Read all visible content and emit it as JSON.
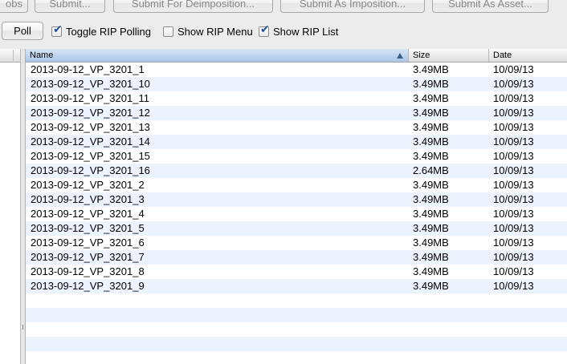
{
  "toolbar_top": {
    "jobs_partial": "obs",
    "submit": "Submit...",
    "submit_deimposition": "Submit For Deimposition...",
    "submit_imposition": "Submit As Imposition...",
    "submit_asset": "Submit As Asset..."
  },
  "toolbar_second": {
    "poll": "Poll",
    "toggle_rip_polling": {
      "label": "Toggle RIP Polling",
      "checked": true
    },
    "show_rip_menu": {
      "label": "Show RIP Menu",
      "checked": false
    },
    "show_rip_list": {
      "label": "Show RIP List",
      "checked": true
    }
  },
  "table": {
    "columns": {
      "name": "Name",
      "size": "Size",
      "date": "Date"
    },
    "sort": {
      "column": "name",
      "direction": "ascending"
    },
    "rows": [
      {
        "name": "2013-09-12_VP_3201_1",
        "size": "3.49MB",
        "date": "10/09/13"
      },
      {
        "name": "2013-09-12_VP_3201_10",
        "size": "3.49MB",
        "date": "10/09/13"
      },
      {
        "name": "2013-09-12_VP_3201_11",
        "size": "3.49MB",
        "date": "10/09/13"
      },
      {
        "name": "2013-09-12_VP_3201_12",
        "size": "3.49MB",
        "date": "10/09/13"
      },
      {
        "name": "2013-09-12_VP_3201_13",
        "size": "3.49MB",
        "date": "10/09/13"
      },
      {
        "name": "2013-09-12_VP_3201_14",
        "size": "3.49MB",
        "date": "10/09/13"
      },
      {
        "name": "2013-09-12_VP_3201_15",
        "size": "3.49MB",
        "date": "10/09/13"
      },
      {
        "name": "2013-09-12_VP_3201_16",
        "size": "2.64MB",
        "date": "10/09/13"
      },
      {
        "name": "2013-09-12_VP_3201_2",
        "size": "3.49MB",
        "date": "10/09/13"
      },
      {
        "name": "2013-09-12_VP_3201_3",
        "size": "3.49MB",
        "date": "10/09/13"
      },
      {
        "name": "2013-09-12_VP_3201_4",
        "size": "3.49MB",
        "date": "10/09/13"
      },
      {
        "name": "2013-09-12_VP_3201_5",
        "size": "3.49MB",
        "date": "10/09/13"
      },
      {
        "name": "2013-09-12_VP_3201_6",
        "size": "3.49MB",
        "date": "10/09/13"
      },
      {
        "name": "2013-09-12_VP_3201_7",
        "size": "3.49MB",
        "date": "10/09/13"
      },
      {
        "name": "2013-09-12_VP_3201_8",
        "size": "3.49MB",
        "date": "10/09/13"
      },
      {
        "name": "2013-09-12_VP_3201_9",
        "size": "3.49MB",
        "date": "10/09/13"
      }
    ]
  },
  "colors": {
    "row_alt": "#edf3fe",
    "checkmark": "#1f4fa0",
    "sort_header": "#a9c6e8"
  }
}
